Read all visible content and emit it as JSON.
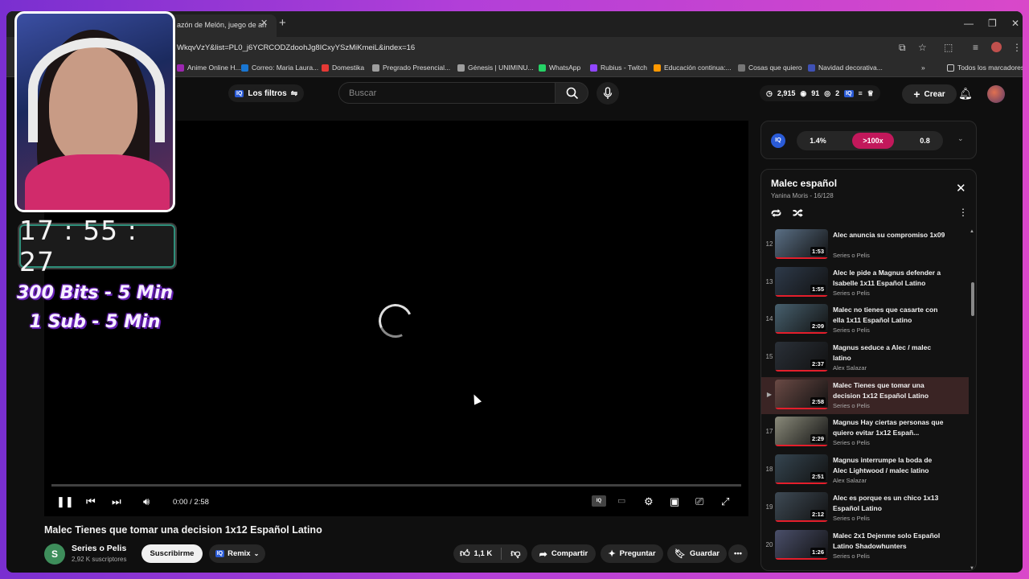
{
  "browser": {
    "tab_title": "azón de Melón, juego de an",
    "url": "WkqvVzY&list=PL0_j6YCRCODZdoohJg8ICxyYSzMiKmeiL&index=16",
    "bookmarks": [
      {
        "label": "Anime Online H...",
        "color": "#9c27b0"
      },
      {
        "label": "Correo: Maria Laura...",
        "color": "#1976d2"
      },
      {
        "label": "Domestika",
        "color": "#e53935"
      },
      {
        "label": "Pregrado Presencial...",
        "color": "#9e9e9e"
      },
      {
        "label": "Génesis | UNIMINU...",
        "color": "#9e9e9e"
      },
      {
        "label": "WhatsApp",
        "color": "#25d366"
      },
      {
        "label": "Rubius - Twitch",
        "color": "#9146ff"
      },
      {
        "label": "Educación continua:...",
        "color": "#ff9800"
      },
      {
        "label": "Cosas que quiero",
        "color": "#777777"
      },
      {
        "label": "Navidad decorativa...",
        "color": "#3f51b5"
      }
    ],
    "all_bookmarks_label": "Todos los marcadores"
  },
  "header": {
    "filters_label": "Los filtros",
    "search_placeholder": "Buscar",
    "stats": {
      "views": "2,915",
      "eye": "91",
      "other": "2"
    },
    "create_label": "Crear"
  },
  "player": {
    "time": "0:00 / 2:58",
    "progress": 0
  },
  "video": {
    "title": "Malec Tienes que tomar una decision 1x12 Español Latino",
    "channel": "Series o Pelis",
    "channel_initial": "S",
    "subscribers": "2,92 K suscriptores",
    "subscribe_label": "Suscribirme",
    "remix_label": "Remix",
    "likes": "1,1 K",
    "share_label": "Compartir",
    "ask_label": "Preguntar",
    "save_label": "Guardar"
  },
  "iq_widget": {
    "stat1": "1.4%",
    "stat2": ">100x",
    "stat3": "0.8"
  },
  "playlist": {
    "title": "Malec español",
    "subtitle": "Yanina Moris - 16/128",
    "items": [
      {
        "index": "12",
        "title": "Alec anuncia su compromiso 1x09",
        "channel": "Series o Pelis",
        "duration": "1:53",
        "current": false
      },
      {
        "index": "13",
        "title": "Alec le pide a Magnus defender a Isabelle 1x11 Español Latino",
        "channel": "Series o Pelis",
        "duration": "1:55",
        "current": false
      },
      {
        "index": "14",
        "title": "Malec no tienes que casarte con ella 1x11 Español Latino",
        "channel": "Series o Pelis",
        "duration": "2:09",
        "current": false
      },
      {
        "index": "15",
        "title": "Magnus seduce a Alec / malec latino",
        "channel": "Alex Salazar",
        "duration": "2:37",
        "current": false
      },
      {
        "index": "▶",
        "title": "Malec Tienes que tomar una decision 1x12 Español Latino",
        "channel": "Series o Pelis",
        "duration": "2:58",
        "current": true
      },
      {
        "index": "17",
        "title": "Magnus Hay ciertas personas que quiero evitar 1x12 Españ...",
        "channel": "Series o Pelis",
        "duration": "2:29",
        "current": false
      },
      {
        "index": "18",
        "title": "Magnus interrumpe la boda de Alec Lightwood / malec latino",
        "channel": "Alex Salazar",
        "duration": "2:51",
        "current": false
      },
      {
        "index": "19",
        "title": "Alec es porque es un chico 1x13 Español Latino",
        "channel": "Series o Pelis",
        "duration": "2:12",
        "current": false
      },
      {
        "index": "20",
        "title": "Malec 2x1 Dejenme solo Español Latino Shadowhunters",
        "channel": "Series o Pelis",
        "duration": "1:26",
        "current": false
      }
    ]
  },
  "overlay": {
    "timer": "17 : 55 : 27",
    "promo_line1": "300 Bits - 5 Min",
    "promo_line2": "1 Sub - 5 Min"
  }
}
